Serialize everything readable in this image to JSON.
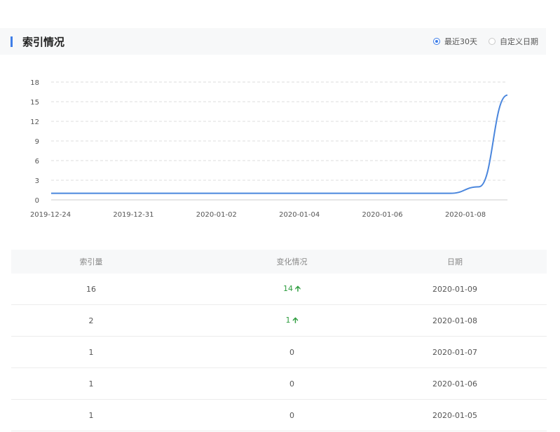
{
  "header": {
    "title": "索引情况",
    "range_options": [
      {
        "label": "最近30天",
        "selected": true
      },
      {
        "label": "自定义日期",
        "selected": false
      }
    ]
  },
  "colors": {
    "accent": "#3f7ee8",
    "line": "#4a86dd",
    "up": "#2e9d3f"
  },
  "chart_data": {
    "type": "line",
    "x_tick_labels": [
      "2019-12-24",
      "2019-12-31",
      "2020-01-02",
      "2020-01-04",
      "2020-01-06",
      "2020-01-08"
    ],
    "y_ticks": [
      0,
      3,
      6,
      9,
      12,
      15,
      18
    ],
    "ylim": [
      0,
      18
    ],
    "grid": true,
    "series": [
      {
        "x": [
          "2019-12-24",
          "2019-12-25",
          "2019-12-26",
          "2019-12-27",
          "2019-12-28",
          "2019-12-29",
          "2019-12-30",
          "2019-12-31",
          "2020-01-01",
          "2020-01-02",
          "2020-01-03",
          "2020-01-04",
          "2020-01-05",
          "2020-01-06",
          "2020-01-07",
          "2020-01-08",
          "2020-01-09"
        ],
        "values": [
          1,
          1,
          1,
          1,
          1,
          1,
          1,
          1,
          1,
          1,
          1,
          1,
          1,
          1,
          1,
          2,
          16
        ]
      }
    ]
  },
  "table": {
    "headers": [
      "索引量",
      "变化情况",
      "日期"
    ],
    "rows": [
      {
        "count": "16",
        "change": "14",
        "up": true,
        "date": "2020-01-09"
      },
      {
        "count": "2",
        "change": "1",
        "up": true,
        "date": "2020-01-08"
      },
      {
        "count": "1",
        "change": "0",
        "up": false,
        "date": "2020-01-07"
      },
      {
        "count": "1",
        "change": "0",
        "up": false,
        "date": "2020-01-06"
      },
      {
        "count": "1",
        "change": "0",
        "up": false,
        "date": "2020-01-05"
      }
    ]
  }
}
